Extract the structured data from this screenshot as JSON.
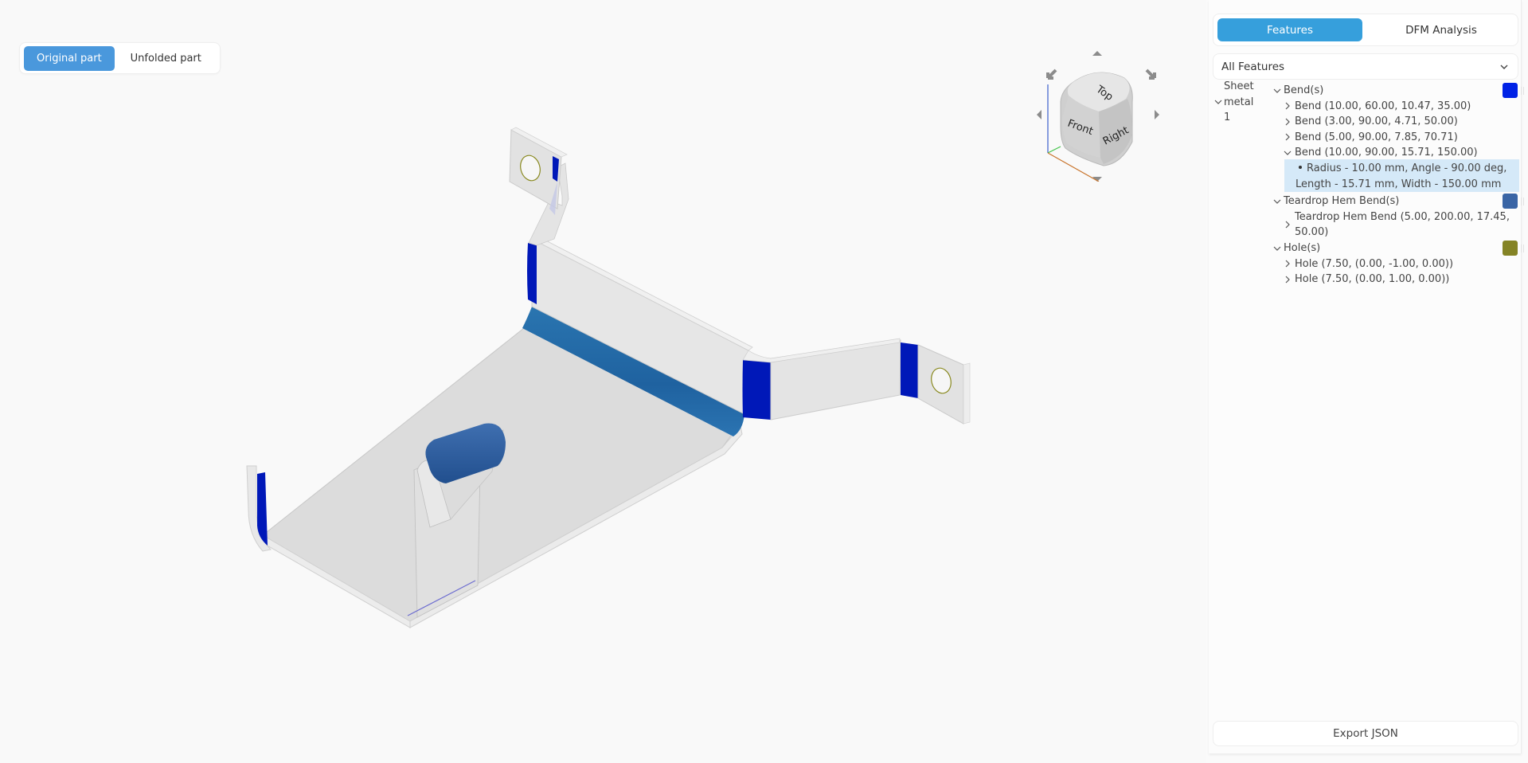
{
  "viewport": {
    "view_toggle": {
      "options": [
        {
          "label": "Original part",
          "active": true
        },
        {
          "label": "Unfolded part",
          "active": false
        }
      ]
    },
    "viewcube": {
      "faces": {
        "top": "Top",
        "front": "Front",
        "right": "Right"
      }
    },
    "colors": {
      "part_surface": "#dedede",
      "bend": "#0018b8",
      "teardrop_hem": "#2f62a3",
      "hole_outline": "#8a8a20",
      "selected_bend": "#2468a8"
    }
  },
  "panel": {
    "tabs": [
      {
        "label": "Features",
        "active": true
      },
      {
        "label": "DFM Analysis",
        "active": false
      }
    ],
    "filter": {
      "selected": "All Features"
    },
    "root": {
      "label_lines": [
        "Sheet",
        "metal",
        "1"
      ],
      "expanded": true
    },
    "groups": [
      {
        "label": "Bend(s)",
        "color": "#0022e6",
        "expanded": true,
        "items": [
          {
            "label": "Bend (10.00, 60.00, 10.47, 35.00)",
            "expanded": false
          },
          {
            "label": "Bend (3.00, 90.00, 4.71, 50.00)",
            "expanded": false
          },
          {
            "label": "Bend (5.00, 90.00, 7.85, 70.71)",
            "expanded": false
          },
          {
            "label": "Bend (10.00, 90.00, 15.71, 150.00)",
            "expanded": true,
            "detail": "Radius - 10.00 mm, Angle - 90.00 deg, Length - 15.71 mm, Width - 150.00 mm"
          }
        ]
      },
      {
        "label": "Teardrop Hem Bend(s)",
        "color": "#3a65a5",
        "expanded": true,
        "items": [
          {
            "label": "Teardrop Hem Bend (5.00, 200.00, 17.45, 50.00)",
            "expanded": false
          }
        ]
      },
      {
        "label": "Hole(s)",
        "color": "#858426",
        "expanded": true,
        "items": [
          {
            "label": "Hole (7.50, (0.00, -1.00, 0.00))",
            "expanded": false
          },
          {
            "label": "Hole (7.50, (0.00, 1.00, 0.00))",
            "expanded": false
          }
        ]
      }
    ],
    "export_label": "Export JSON"
  }
}
